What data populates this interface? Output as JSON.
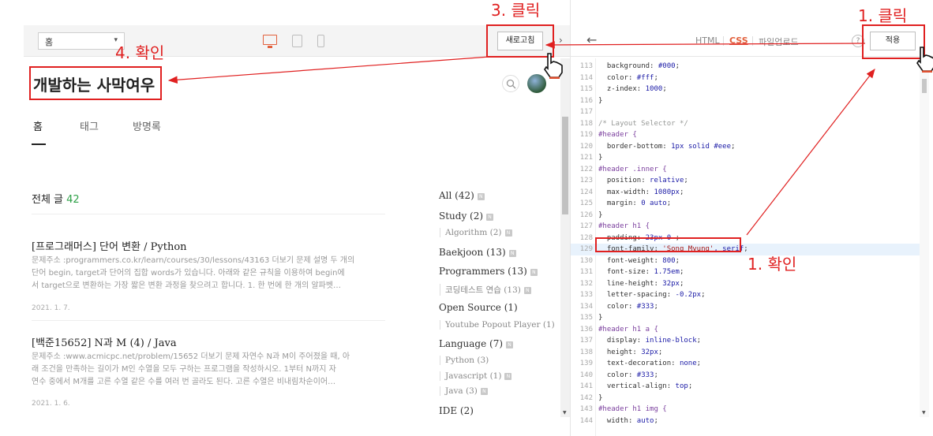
{
  "preview": {
    "page_select": "홈",
    "refresh_label": "새로고침",
    "blog_title": "개발하는 사막여우",
    "nav": [
      "홈",
      "태그",
      "방명록"
    ],
    "total_label": "전체 글",
    "total_count": "42",
    "posts": [
      {
        "title": "[프로그래머스] 단어 변환 / Python",
        "excerpt": [
          "문제주소 :programmers.co.kr/learn/courses/30/lessons/43163 더보기 문제 설명 두 개의",
          "단어 begin, target과 단어의 집합 words가 있습니다. 아래와 같은 규칙을 이용하여 begin에",
          "서 target으로 변환하는 가장 짧은 변환 과정을 찾으려고 합니다. 1. 한 번에 한 개의 알파벳…"
        ],
        "date": "2021. 1. 7."
      },
      {
        "title": "[백준15652] N과 M (4) / Java",
        "excerpt": [
          "문제주소 :www.acmicpc.net/problem/15652 더보기 문제 자연수 N과 M이 주어졌을 때, 아",
          "래 조건을 만족하는 길이가 M인 수열을 모두 구하는 프로그램을 작성하시오. 1부터 N까지 자",
          "연수 중에서 M개를 고른 수열 같은 수를 여러 번 골라도 된다. 고른 수열은 비내림차순이어…"
        ],
        "date": "2021. 1. 6."
      }
    ],
    "categories": [
      {
        "label": "All (42)",
        "sub": false,
        "badge": true
      },
      {
        "label": "Study (2)",
        "sub": false,
        "badge": true
      },
      {
        "label": "Algorithm (2)",
        "sub": true,
        "badge": true
      },
      {
        "label": "Baekjoon (13)",
        "sub": false,
        "badge": true
      },
      {
        "label": "Programmers (13)",
        "sub": false,
        "badge": true
      },
      {
        "label": "코딩테스트 연습 (13)",
        "sub": true,
        "badge": true
      },
      {
        "label": "Open Source (1)",
        "sub": false,
        "badge": false
      },
      {
        "label": "Youtube Popout Player (1)",
        "sub": true,
        "badge": false
      },
      {
        "label": "Language (7)",
        "sub": false,
        "badge": true
      },
      {
        "label": "Python (3)",
        "sub": true,
        "badge": false
      },
      {
        "label": "Javascript (1)",
        "sub": true,
        "badge": true
      },
      {
        "label": "Java (3)",
        "sub": true,
        "badge": true
      },
      {
        "label": "IDE (2)",
        "sub": false,
        "badge": false
      }
    ],
    "badge_glyph": "N"
  },
  "editor": {
    "back_icon": "arrow-left-icon",
    "tabs": [
      "HTML",
      "CSS",
      "파일업로드"
    ],
    "active_tab": "CSS",
    "help_label": "?",
    "apply_label": "적용",
    "highlighted_line": 129,
    "lines": [
      {
        "n": 113,
        "t": "  background: #000;"
      },
      {
        "n": 114,
        "t": "  color: #fff;"
      },
      {
        "n": 115,
        "t": "  z-index: 1000;"
      },
      {
        "n": 116,
        "t": "}"
      },
      {
        "n": 117,
        "t": ""
      },
      {
        "n": 118,
        "t": "/* Layout Selector */"
      },
      {
        "n": 119,
        "t": "#header {"
      },
      {
        "n": 120,
        "t": "  border-bottom: 1px solid #eee;"
      },
      {
        "n": 121,
        "t": "}"
      },
      {
        "n": 122,
        "t": "#header .inner {"
      },
      {
        "n": 123,
        "t": "  position: relative;"
      },
      {
        "n": 124,
        "t": "  max-width: 1080px;"
      },
      {
        "n": 125,
        "t": "  margin: 0 auto;"
      },
      {
        "n": 126,
        "t": "}"
      },
      {
        "n": 127,
        "t": "#header h1 {"
      },
      {
        "n": 128,
        "t": "  padding: 23px 0 ;"
      },
      {
        "n": 129,
        "t": "  font-family: 'Song Myung', serif;"
      },
      {
        "n": 130,
        "t": "  font-weight: 800;"
      },
      {
        "n": 131,
        "t": "  font-size: 1.75em;"
      },
      {
        "n": 132,
        "t": "  line-height: 32px;"
      },
      {
        "n": 133,
        "t": "  letter-spacing: -0.2px;"
      },
      {
        "n": 134,
        "t": "  color: #333;"
      },
      {
        "n": 135,
        "t": "}"
      },
      {
        "n": 136,
        "t": "#header h1 a {"
      },
      {
        "n": 137,
        "t": "  display: inline-block;"
      },
      {
        "n": 138,
        "t": "  height: 32px;"
      },
      {
        "n": 139,
        "t": "  text-decoration: none;"
      },
      {
        "n": 140,
        "t": "  color: #333;"
      },
      {
        "n": 141,
        "t": "  vertical-align: top;"
      },
      {
        "n": 142,
        "t": "}"
      },
      {
        "n": 143,
        "t": "#header h1 img {"
      },
      {
        "n": 144,
        "t": "  width: auto;"
      }
    ]
  },
  "annotations": {
    "step_apply": "1. 클릭",
    "step_confirm_code": "1. 확인",
    "step_refresh": "3. 클릭",
    "step_confirm_title": "4. 확인",
    "color": "#e02020"
  }
}
